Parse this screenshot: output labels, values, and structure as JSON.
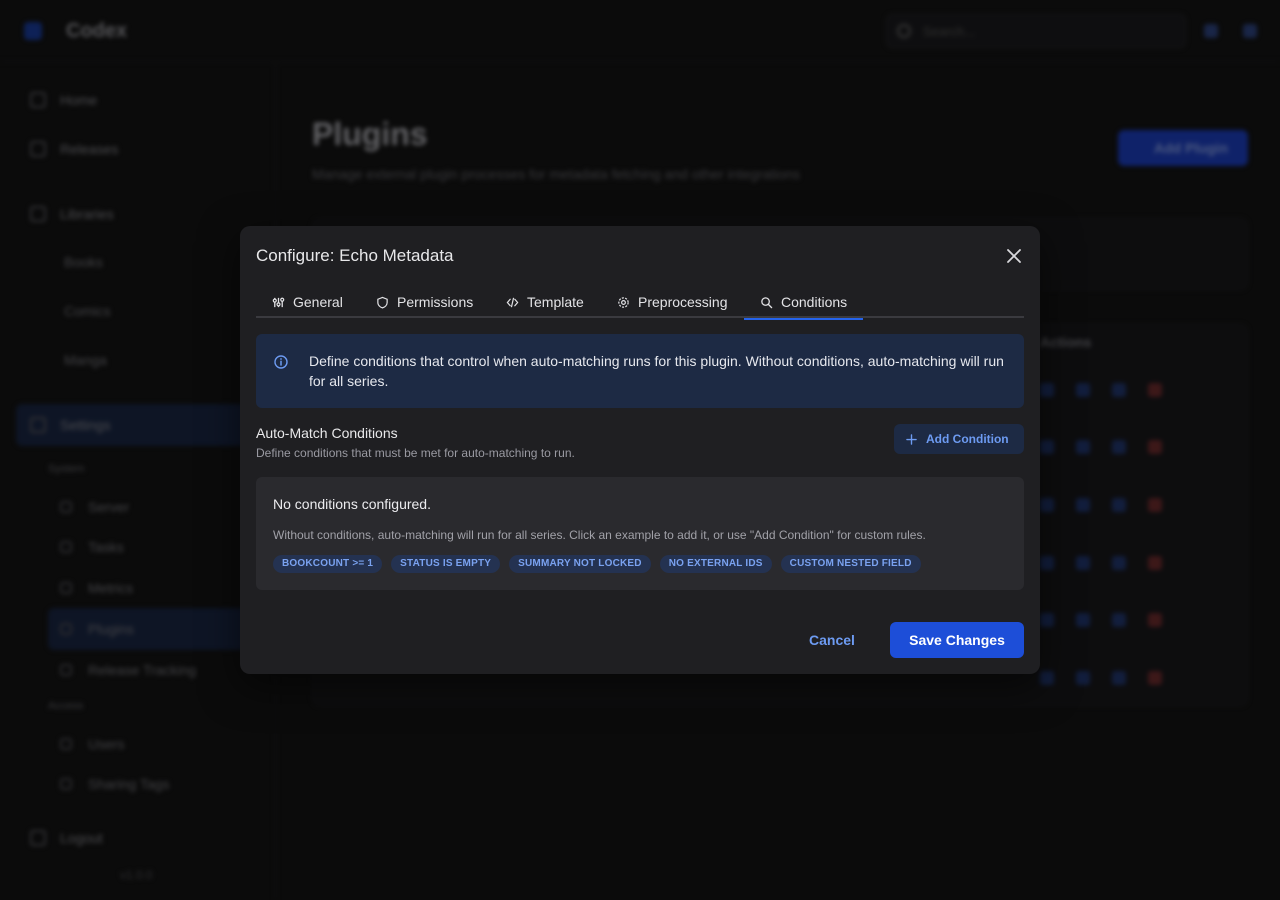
{
  "app": {
    "brand": "Codex",
    "search_placeholder": "Search..."
  },
  "sidebar": {
    "items": [
      {
        "label": "Home",
        "icon": "home-icon"
      },
      {
        "label": "Releases",
        "icon": "releases-icon"
      },
      {
        "label": "Libraries",
        "icon": "libraries-icon"
      }
    ],
    "libraries": [
      "Books",
      "Comics",
      "Manga"
    ],
    "settings_label": "Settings",
    "section_system": "System",
    "system_items": [
      "Server",
      "Tasks",
      "Metrics",
      "Plugins",
      "Release Tracking"
    ],
    "section_access": "Access",
    "access_items": [
      "Users",
      "Sharing Tags"
    ],
    "logout": "Logout",
    "version": "v1.0.0"
  },
  "page": {
    "title": "Plugins",
    "subtitle": "Manage external plugin processes for metadata fetching and other integrations",
    "add_plugin": "Add Plugin",
    "actions_header": "Actions"
  },
  "modal": {
    "title": "Configure: Echo Metadata",
    "tabs": [
      {
        "label": "General",
        "icon": "sliders-icon"
      },
      {
        "label": "Permissions",
        "icon": "shield-icon"
      },
      {
        "label": "Template",
        "icon": "code-icon"
      },
      {
        "label": "Preprocessing",
        "icon": "gear-icon"
      },
      {
        "label": "Conditions",
        "icon": "search-icon"
      }
    ],
    "active_tab": "Conditions",
    "info_text": "Define conditions that control when auto-matching runs for this plugin. Without conditions, auto-matching will run for all series.",
    "conditions_title": "Auto-Match Conditions",
    "conditions_subtitle": "Define conditions that must be met for auto-matching to run.",
    "add_condition": "Add Condition",
    "empty_title": "No conditions configured.",
    "empty_desc": "Without conditions, auto-matching will run for all series. Click an example to add it, or use \"Add Condition\" for custom rules.",
    "examples": [
      "BOOKCOUNT >= 1",
      "STATUS IS EMPTY",
      "SUMMARY NOT LOCKED",
      "NO EXTERNAL IDS",
      "CUSTOM NESTED FIELD"
    ],
    "cancel": "Cancel",
    "save": "Save Changes"
  },
  "colors": {
    "accent": "#1d4ed8",
    "link": "#6d9bf2",
    "modal_bg": "#1f1f22",
    "info_bg": "#1d2a44"
  }
}
